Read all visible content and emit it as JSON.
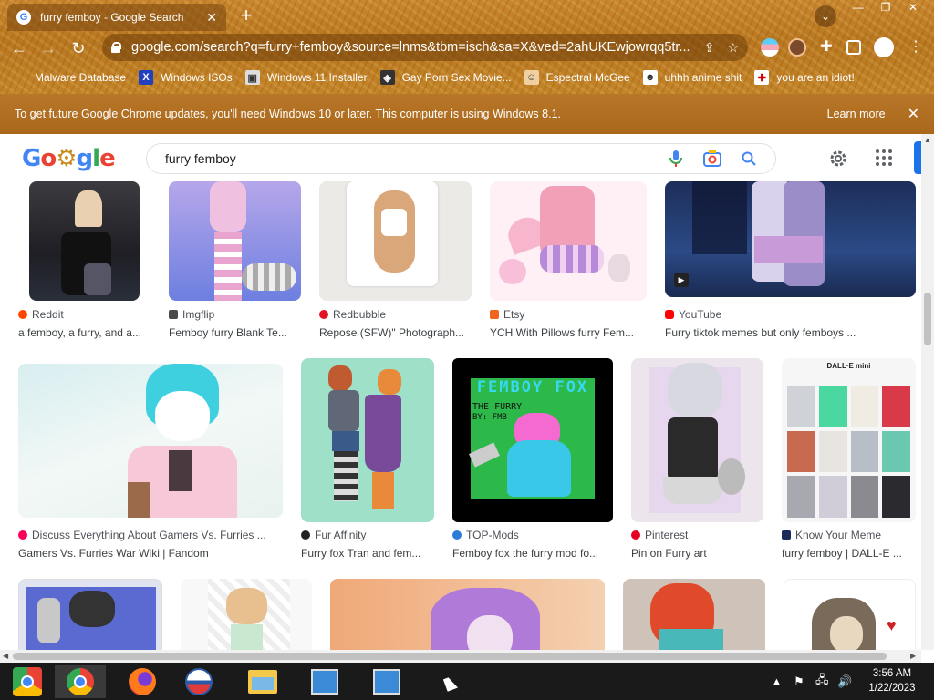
{
  "browser": {
    "tab_title": "furry femboy - Google Search",
    "url": "google.com/search?q=furry+femboy&source=lnms&tbm=isch&sa=X&ved=2ahUKEwjowrqq5tr..."
  },
  "bookmarks": [
    {
      "label": "Malware Database"
    },
    {
      "label": "Windows ISOs"
    },
    {
      "label": "Windows 11 Installer"
    },
    {
      "label": "Gay Porn Sex Movie..."
    },
    {
      "label": "Espectral McGee"
    },
    {
      "label": "uhhh anime shit"
    },
    {
      "label": "you are an idiot!"
    }
  ],
  "infobar": {
    "message": "To get future Google Chrome updates, you'll need Windows 10 or later. This computer is using Windows 8.1.",
    "learn_more": "Learn more"
  },
  "search": {
    "query": "furry femboy"
  },
  "results": [
    {
      "source": "Reddit",
      "caption": "a femboy, a furry, and a...",
      "fav": "#ff4500"
    },
    {
      "source": "Imgflip",
      "caption": "Femboy furry Blank Te...",
      "fav": "#4a4a4a"
    },
    {
      "source": "Redbubble",
      "caption": "Repose (SFW)\" Photograph...",
      "fav": "#e41321"
    },
    {
      "source": "Etsy",
      "caption": "YCH With Pillows furry Fem...",
      "fav": "#f1641e"
    },
    {
      "source": "YouTube",
      "caption": "Furry tiktok memes but only femboys ...",
      "fav": "#ff0000"
    },
    {
      "source": "Discuss Everything About Gamers Vs. Furries ...",
      "caption": "Gamers Vs. Furries War Wiki | Fandom",
      "fav": "#fa005a"
    },
    {
      "source": "Fur Affinity",
      "caption": "Furry fox Tran and fem...",
      "fav": "#222"
    },
    {
      "source": "TOP-Mods",
      "caption": "Femboy fox the furry mod fo...",
      "fav": "#2b7bd8"
    },
    {
      "source": "Pinterest",
      "caption": "Pin on Furry art",
      "fav": "#e60023"
    },
    {
      "source": "Know Your Meme",
      "caption": "furry femboy | DALL-E ...",
      "fav": "#1c2a5a"
    }
  ],
  "thumb_text": {
    "femboy_fox_title": "FEMBOY FOX",
    "femboy_fox_sub": "THE FURRY",
    "femboy_fox_by": "BY: FMB",
    "dalle_title": "DALL·E mini"
  },
  "clock": {
    "time": "3:56 AM",
    "date": "1/22/2023"
  }
}
